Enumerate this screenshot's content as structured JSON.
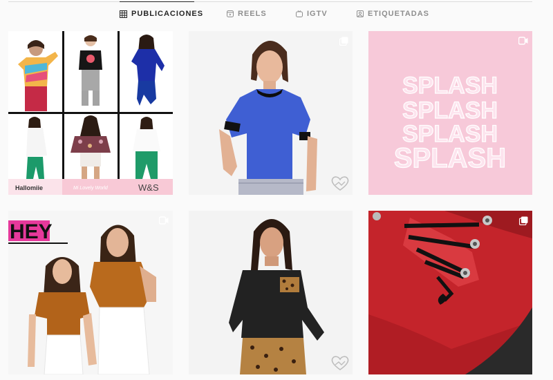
{
  "tabs": [
    {
      "label": "PUBLICACIONES",
      "icon": "grid-icon",
      "active": true
    },
    {
      "label": "REELS",
      "icon": "reels-icon",
      "active": false
    },
    {
      "label": "IGTV",
      "icon": "igtv-icon",
      "active": false
    },
    {
      "label": "ETIQUETADAS",
      "icon": "tag-icon",
      "active": false
    }
  ],
  "posts": [
    {
      "type": "video",
      "description": "collage of children and women modeling outfits",
      "brands": [
        "Hallomiie",
        "Mi Lovely World",
        "W&S"
      ]
    },
    {
      "type": "carousel",
      "description": "woman in royal blue puff-sleeve top",
      "watermark": "heart-logo"
    },
    {
      "type": "video",
      "description": "pink splash text graphic",
      "text_lines": [
        "SPLASH",
        "SPLASH",
        "SPLASH",
        "SPLASH"
      ]
    },
    {
      "type": "video",
      "description": "girl and woman in rust velvet tops",
      "headline": "HEY"
    },
    {
      "type": "photo",
      "description": "woman in black top with leopard pocket",
      "watermark": "heart-logo"
    },
    {
      "type": "carousel",
      "description": "close-up of red leather lace-up boot"
    }
  ],
  "colors": {
    "accent_pink": "#f7c9d9",
    "blue_top": "#3f5fd3",
    "red_boot": "#c4242b",
    "rust": "#b96a1d"
  }
}
